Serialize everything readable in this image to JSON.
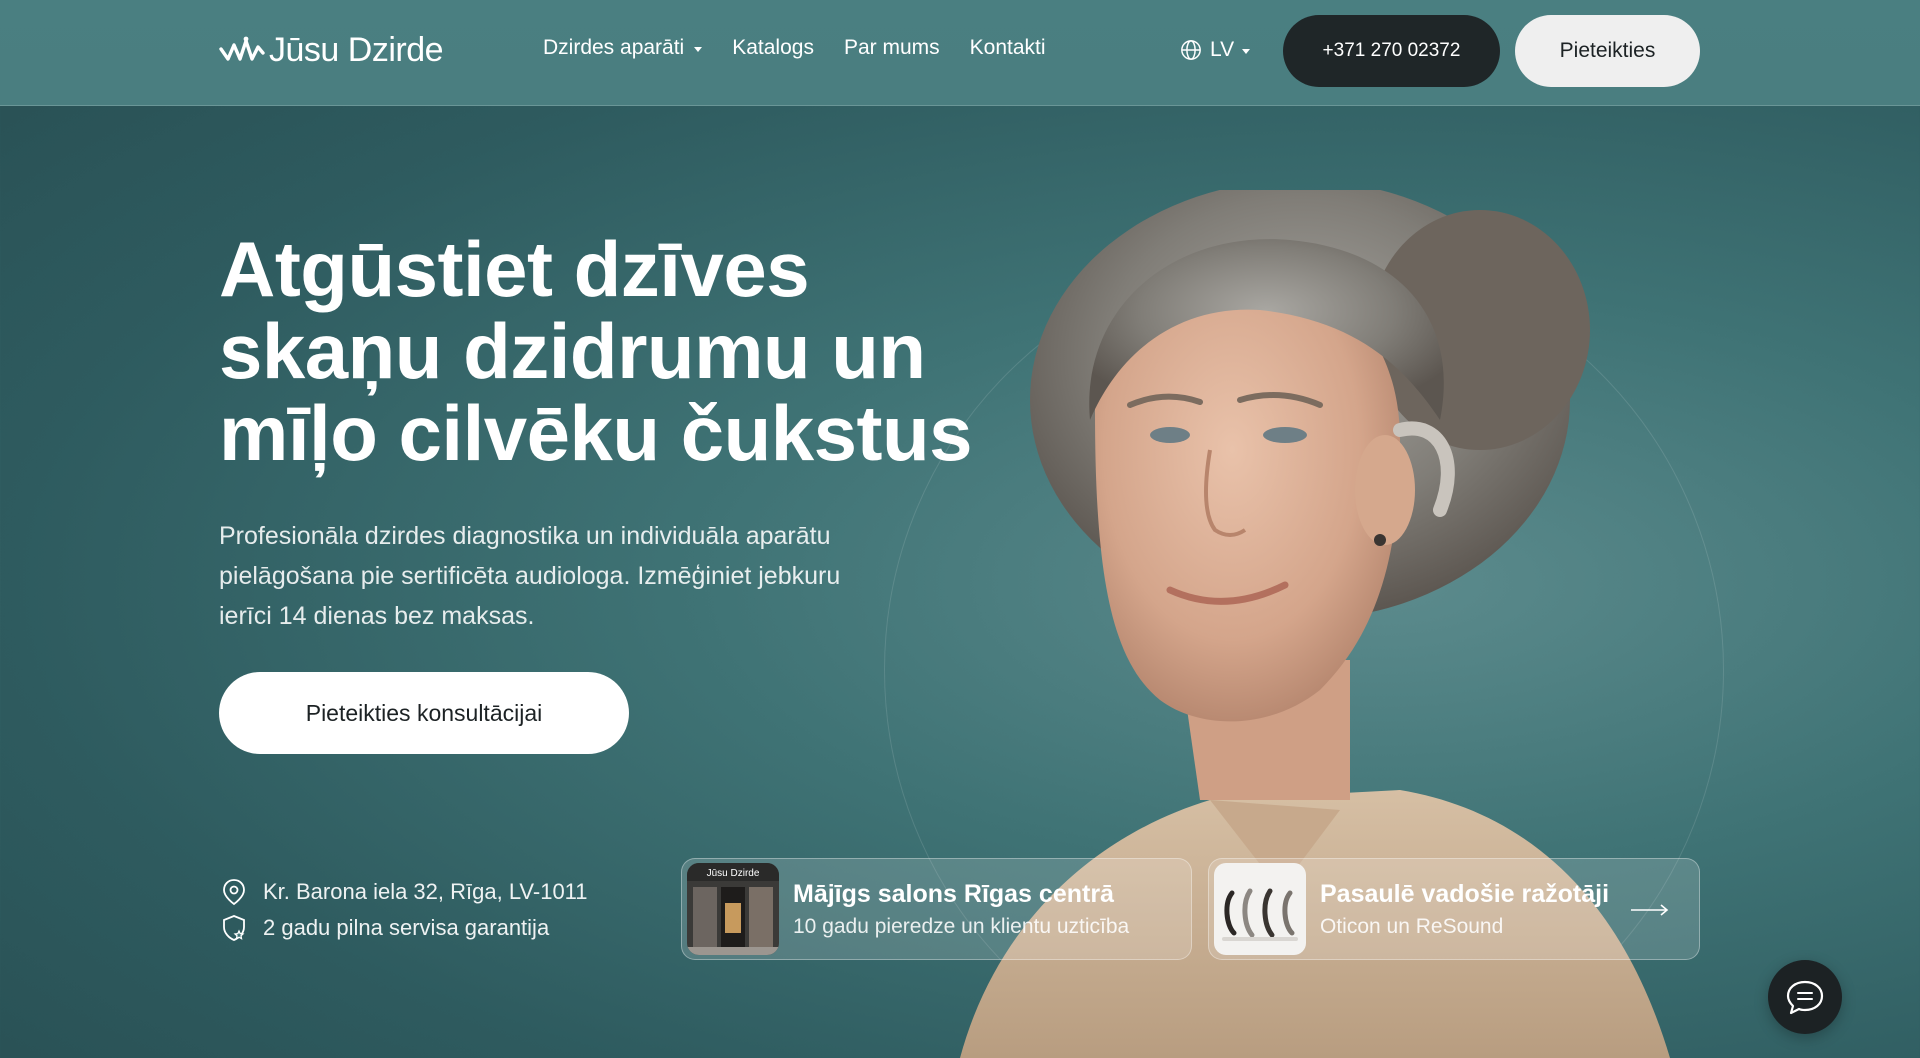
{
  "brand": {
    "logo_text": "Jūsu Dzirde"
  },
  "nav": {
    "items": [
      {
        "label": "Dzirdes aparāti",
        "has_dropdown": true
      },
      {
        "label": "Katalogs",
        "has_dropdown": false
      },
      {
        "label": "Par mums",
        "has_dropdown": false
      },
      {
        "label": "Kontakti",
        "has_dropdown": false
      }
    ],
    "language": "LV",
    "phone": "+371 270 02372",
    "signup_label": "Pieteikties"
  },
  "hero": {
    "title_lines": [
      "Atgūstiet dzīves",
      "skaņu dzidrumu un",
      "mīļo cilvēku čukstus"
    ],
    "subtitle_lines": [
      "Profesionāla dzirdes diagnostika un individuāla aparātu",
      "pielāgošana pie sertificēta audiologa. Izmēģiniet jebkuru",
      "ierīci 14 dienas bez maksas."
    ],
    "cta_label": "Pieteikties konsultācijai"
  },
  "info": {
    "address": "Kr. Barona iela 32, Rīga, LV-1011",
    "warranty": "2 gadu pilna servisa garantija"
  },
  "cards": [
    {
      "title": "Mājīgs salons Rīgas centrā",
      "desc": "10 gadu pieredze un klientu uzticība",
      "thumb_label": "Jūsu Dzirde"
    },
    {
      "title": "Pasaulē vadošie ražotāji",
      "desc": "Oticon un ReSound"
    }
  ],
  "colors": {
    "background": "#3f7375",
    "header": "#4a7e80",
    "dark_button": "#1f2628",
    "light_button": "#efefef"
  },
  "icons": [
    "globe-icon",
    "location-pin-icon",
    "shield-star-icon",
    "arrow-right-icon",
    "chat-icon"
  ]
}
